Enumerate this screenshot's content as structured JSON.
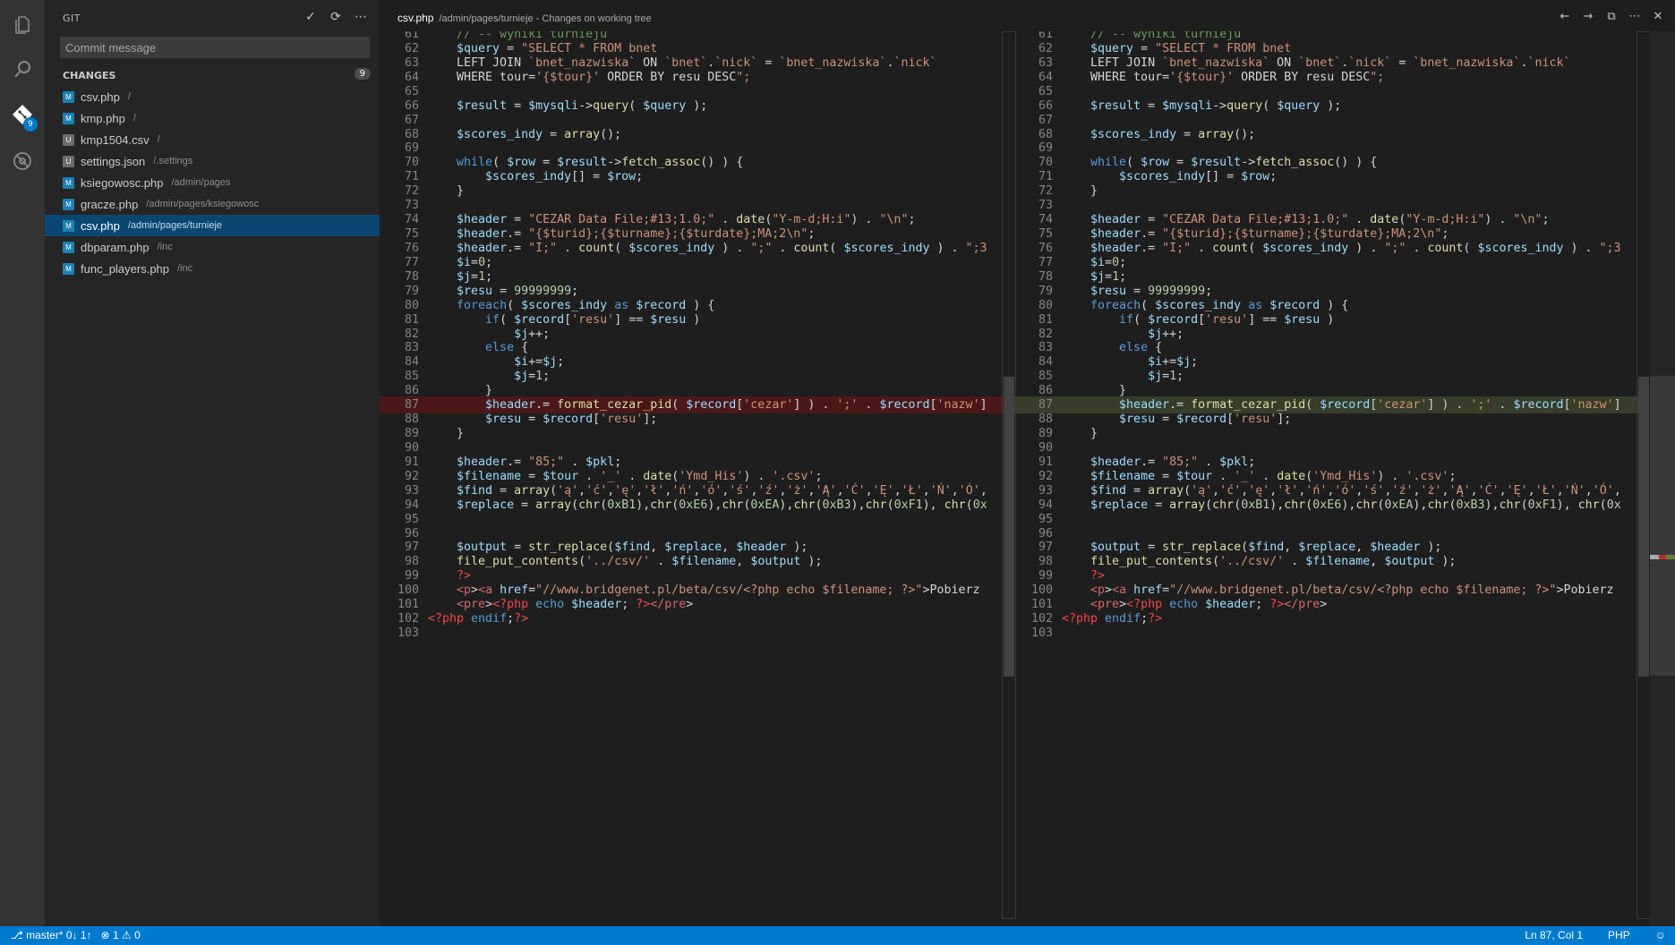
{
  "sidebar": {
    "title": "GIT",
    "commit_placeholder": "Commit message",
    "changes_label": "CHANGES",
    "changes_count": "9",
    "files": [
      {
        "status": "M",
        "name": "csv.php",
        "path": "/"
      },
      {
        "status": "M",
        "name": "kmp.php",
        "path": "/"
      },
      {
        "status": "U",
        "name": "kmp1504.csv",
        "path": "/"
      },
      {
        "status": "U",
        "name": "settings.json",
        "path": "/.settings"
      },
      {
        "status": "M",
        "name": "ksiegowosc.php",
        "path": "/admin/pages"
      },
      {
        "status": "M",
        "name": "gracze.php",
        "path": "/admin/pages/ksiegowosc"
      },
      {
        "status": "M",
        "name": "csv.php",
        "path": "/admin/pages/turnieje"
      },
      {
        "status": "M",
        "name": "dbparam.php",
        "path": "/inc"
      },
      {
        "status": "M",
        "name": "func_players.php",
        "path": "/inc"
      }
    ],
    "selected_index": 6
  },
  "activity": {
    "scm_badge": "9"
  },
  "editor": {
    "title": "csv.php",
    "subtitle": "/admin/pages/turnieje - Changes on working tree",
    "left_lines": [
      {
        "n": "61",
        "t": "    // -- wyniki turnieju",
        "k": ""
      },
      {
        "n": "62",
        "t": "    $query = \"SELECT * FROM bnet",
        "k": ""
      },
      {
        "n": "63",
        "t": "    LEFT JOIN `bnet_nazwiska` ON `bnet`.`nick` = `bnet_nazwiska`.`nick`",
        "k": ""
      },
      {
        "n": "64",
        "t": "    WHERE tour='{$tour}' ORDER BY resu DESC\";",
        "k": ""
      },
      {
        "n": "65",
        "t": "",
        "k": ""
      },
      {
        "n": "66",
        "t": "    $result = $mysqli->query( $query );",
        "k": ""
      },
      {
        "n": "67",
        "t": "",
        "k": ""
      },
      {
        "n": "68",
        "t": "    $scores_indy = array();",
        "k": ""
      },
      {
        "n": "69",
        "t": "",
        "k": ""
      },
      {
        "n": "70",
        "t": "    while( $row = $result->fetch_assoc() ) {",
        "k": ""
      },
      {
        "n": "71",
        "t": "        $scores_indy[] = $row;",
        "k": ""
      },
      {
        "n": "72",
        "t": "    }",
        "k": ""
      },
      {
        "n": "73",
        "t": "",
        "k": ""
      },
      {
        "n": "74",
        "t": "    $header = \"CEZAR Data File;#13;1.0;\" . date(\"Y-m-d;H:i\") . \"\\n\";",
        "k": ""
      },
      {
        "n": "75",
        "t": "    $header.= \"{$turid};{$turname};{$turdate};MA;2\\n\";",
        "k": ""
      },
      {
        "n": "76",
        "t": "    $header.= \"I;\" . count( $scores_indy ) . \";\" . count( $scores_indy ) . \";3",
        "k": ""
      },
      {
        "n": "77",
        "t": "    $i=0;",
        "k": ""
      },
      {
        "n": "78",
        "t": "    $j=1;",
        "k": ""
      },
      {
        "n": "79",
        "t": "    $resu = 99999999;",
        "k": ""
      },
      {
        "n": "80",
        "t": "    foreach( $scores_indy as $record ) {",
        "k": ""
      },
      {
        "n": "81",
        "t": "        if( $record['resu'] == $resu )",
        "k": ""
      },
      {
        "n": "82",
        "t": "            $j++;",
        "k": ""
      },
      {
        "n": "83",
        "t": "        else {",
        "k": ""
      },
      {
        "n": "84",
        "t": "            $i+=$j;",
        "k": ""
      },
      {
        "n": "85",
        "t": "            $j=1;",
        "k": ""
      },
      {
        "n": "86",
        "t": "        }",
        "k": ""
      },
      {
        "n": "87",
        "t": "        $header.= format_cezar_pid( $record['cezar'] ) . ';' . $record['nazw']",
        "k": "del"
      },
      {
        "n": "88",
        "t": "        $resu = $record['resu'];",
        "k": ""
      },
      {
        "n": "89",
        "t": "    }",
        "k": ""
      },
      {
        "n": "90",
        "t": "",
        "k": ""
      },
      {
        "n": "91",
        "t": "    $header.= \"85;\" . $pkl;",
        "k": ""
      },
      {
        "n": "92",
        "t": "    $filename = $tour . '_' . date('Ymd_His') . '.csv';",
        "k": ""
      },
      {
        "n": "93",
        "t": "    $find = array('ą','ć','ę','ł','ń','ó','ś','ź','ż','Ą','Ć','Ę','Ł','Ń','Ó',",
        "k": ""
      },
      {
        "n": "94",
        "t": "    $replace = array(chr(0xB1),chr(0xE6),chr(0xEA),chr(0xB3),chr(0xF1), chr(0x",
        "k": ""
      },
      {
        "n": "95",
        "t": "",
        "k": ""
      },
      {
        "n": "96",
        "t": "",
        "k": ""
      },
      {
        "n": "97",
        "t": "    $output = str_replace($find, $replace, $header );",
        "k": ""
      },
      {
        "n": "98",
        "t": "    file_put_contents('../csv/' . $filename, $output );",
        "k": ""
      },
      {
        "n": "99",
        "t": "    ?>",
        "k": ""
      },
      {
        "n": "100",
        "t": "    <p><a href=\"//www.bridgenet.pl/beta/csv/<?php echo $filename; ?>\">Pobierz",
        "k": ""
      },
      {
        "n": "101",
        "t": "    <pre><?php echo $header; ?></pre>",
        "k": ""
      },
      {
        "n": "102",
        "t": "<?php endif;?>",
        "k": ""
      },
      {
        "n": "103",
        "t": "",
        "k": ""
      }
    ],
    "right_lines": [
      {
        "n": "61",
        "t": "    // -- wyniki turnieju",
        "k": ""
      },
      {
        "n": "62",
        "t": "    $query = \"SELECT * FROM bnet",
        "k": ""
      },
      {
        "n": "63",
        "t": "    LEFT JOIN `bnet_nazwiska` ON `bnet`.`nick` = `bnet_nazwiska`.`nick`",
        "k": ""
      },
      {
        "n": "64",
        "t": "    WHERE tour='{$tour}' ORDER BY resu DESC\";",
        "k": ""
      },
      {
        "n": "65",
        "t": "",
        "k": ""
      },
      {
        "n": "66",
        "t": "    $result = $mysqli->query( $query );",
        "k": ""
      },
      {
        "n": "67",
        "t": "",
        "k": ""
      },
      {
        "n": "68",
        "t": "    $scores_indy = array();",
        "k": ""
      },
      {
        "n": "69",
        "t": "",
        "k": ""
      },
      {
        "n": "70",
        "t": "    while( $row = $result->fetch_assoc() ) {",
        "k": ""
      },
      {
        "n": "71",
        "t": "        $scores_indy[] = $row;",
        "k": ""
      },
      {
        "n": "72",
        "t": "    }",
        "k": ""
      },
      {
        "n": "73",
        "t": "",
        "k": ""
      },
      {
        "n": "74",
        "t": "    $header = \"CEZAR Data File;#13;1.0;\" . date(\"Y-m-d;H:i\") . \"\\n\";",
        "k": ""
      },
      {
        "n": "75",
        "t": "    $header.= \"{$turid};{$turname};{$turdate};MA;2\\n\";",
        "k": ""
      },
      {
        "n": "76",
        "t": "    $header.= \"I;\" . count( $scores_indy ) . \";\" . count( $scores_indy ) . \";3",
        "k": ""
      },
      {
        "n": "77",
        "t": "    $i=0;",
        "k": ""
      },
      {
        "n": "78",
        "t": "    $j=1;",
        "k": ""
      },
      {
        "n": "79",
        "t": "    $resu = 99999999;",
        "k": ""
      },
      {
        "n": "80",
        "t": "    foreach( $scores_indy as $record ) {",
        "k": ""
      },
      {
        "n": "81",
        "t": "        if( $record['resu'] == $resu )",
        "k": ""
      },
      {
        "n": "82",
        "t": "            $j++;",
        "k": ""
      },
      {
        "n": "83",
        "t": "        else {",
        "k": ""
      },
      {
        "n": "84",
        "t": "            $i+=$j;",
        "k": ""
      },
      {
        "n": "85",
        "t": "            $j=1;",
        "k": ""
      },
      {
        "n": "86",
        "t": "        }",
        "k": ""
      },
      {
        "n": "87",
        "t": "        $header.= format_cezar_pid( $record['cezar'] ) . ';' . $record['nazw']",
        "k": "ins"
      },
      {
        "n": "88",
        "t": "        $resu = $record['resu'];",
        "k": ""
      },
      {
        "n": "89",
        "t": "    }",
        "k": ""
      },
      {
        "n": "90",
        "t": "",
        "k": ""
      },
      {
        "n": "91",
        "t": "    $header.= \"85;\" . $pkl;",
        "k": ""
      },
      {
        "n": "92",
        "t": "    $filename = $tour . '_' . date('Ymd_His') . '.csv';",
        "k": ""
      },
      {
        "n": "93",
        "t": "    $find = array('ą','ć','ę','ł','ń','ó','ś','ź','ż','Ą','Ć','Ę','Ł','Ń','Ó',",
        "k": ""
      },
      {
        "n": "94",
        "t": "    $replace = array(chr(0xB1),chr(0xE6),chr(0xEA),chr(0xB3),chr(0xF1), chr(0x",
        "k": ""
      },
      {
        "n": "95",
        "t": "",
        "k": ""
      },
      {
        "n": "96",
        "t": "",
        "k": ""
      },
      {
        "n": "97",
        "t": "    $output = str_replace($find, $replace, $header );",
        "k": ""
      },
      {
        "n": "98",
        "t": "    file_put_contents('../csv/' . $filename, $output );",
        "k": ""
      },
      {
        "n": "99",
        "t": "    ?>",
        "k": ""
      },
      {
        "n": "100",
        "t": "    <p><a href=\"//www.bridgenet.pl/beta/csv/<?php echo $filename; ?>\">Pobierz",
        "k": ""
      },
      {
        "n": "101",
        "t": "    <pre><?php echo $header; ?></pre>",
        "k": ""
      },
      {
        "n": "102",
        "t": "<?php endif;?>",
        "k": ""
      },
      {
        "n": "103",
        "t": "",
        "k": ""
      }
    ]
  },
  "status": {
    "branch": "master*",
    "sync": "0↓ 1↑",
    "errors": "1",
    "warnings": "0",
    "position": "Ln 87, Col 1",
    "language": "PHP"
  },
  "colors": {
    "accent": "#007acc",
    "deleted_line": "#4b1818",
    "inserted_line": "#373d29"
  }
}
